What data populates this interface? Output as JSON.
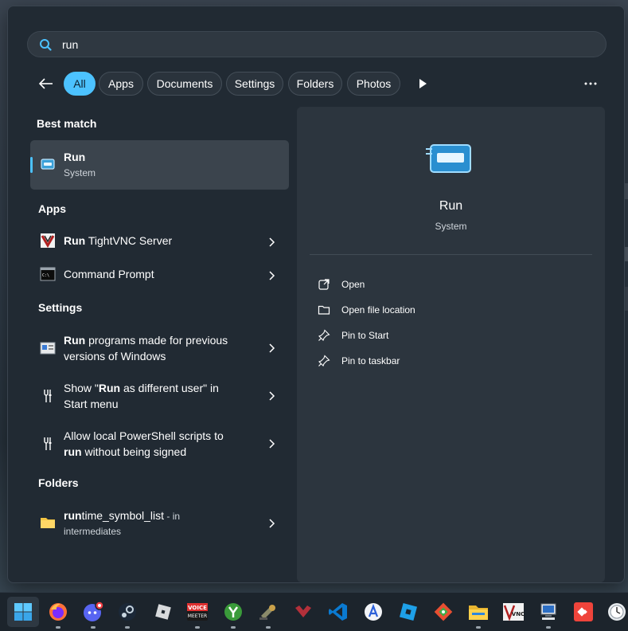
{
  "search": {
    "query": "run"
  },
  "filters": [
    {
      "label": "All",
      "active": true
    },
    {
      "label": "Apps",
      "active": false
    },
    {
      "label": "Documents",
      "active": false
    },
    {
      "label": "Settings",
      "active": false
    },
    {
      "label": "Folders",
      "active": false
    },
    {
      "label": "Photos",
      "active": false
    }
  ],
  "best_match": {
    "title": "Best match",
    "item": {
      "name": "Run",
      "subtitle": "System"
    }
  },
  "apps": {
    "title": "Apps",
    "items": [
      {
        "bold": "Run",
        "rest": " TightVNC Server"
      },
      {
        "bold": "",
        "rest": "Command Prompt"
      }
    ]
  },
  "settings": {
    "title": "Settings",
    "items": [
      {
        "line1_bold": "Run",
        "line1_rest": " programs made for previous",
        "line2_bold": "",
        "line2_rest": "versions of Windows"
      },
      {
        "line1_pre": "Show \"",
        "line1_bold": "Run",
        "line1_rest": " as different user\" in",
        "line2_bold": "",
        "line2_rest": "Start menu"
      },
      {
        "line1_pre": "",
        "line1_bold": "",
        "line1_rest": "Allow local PowerShell scripts to",
        "line2_bold": "run",
        "line2_rest": " without being signed"
      }
    ]
  },
  "folders": {
    "title": "Folders",
    "items": [
      {
        "bold": "run",
        "rest": "time_symbol_list",
        "suffix": " - in",
        "location": "intermediates"
      }
    ]
  },
  "preview": {
    "name": "Run",
    "subtitle": "System",
    "actions": [
      "Open",
      "Open file location",
      "Pin to Start",
      "Pin to taskbar"
    ]
  },
  "taskbar": {
    "apps": [
      "start-icon",
      "firefox-icon",
      "discord-icon",
      "steam-icon",
      "roblox-icon",
      "voicemeeter-icon",
      "app-green-icon",
      "app-tools-icon",
      "app-red-icon",
      "vscode-icon",
      "app-a-icon",
      "roblox-studio-icon",
      "git-icon",
      "file-explorer-icon",
      "vnc-viewer-icon",
      "network-app-icon",
      "anydesk-icon",
      "clock-app-icon"
    ],
    "voicemeeter_label_1": "VOICE",
    "voicemeeter_label_2": "MEETER",
    "vnc_label": "VNC"
  }
}
